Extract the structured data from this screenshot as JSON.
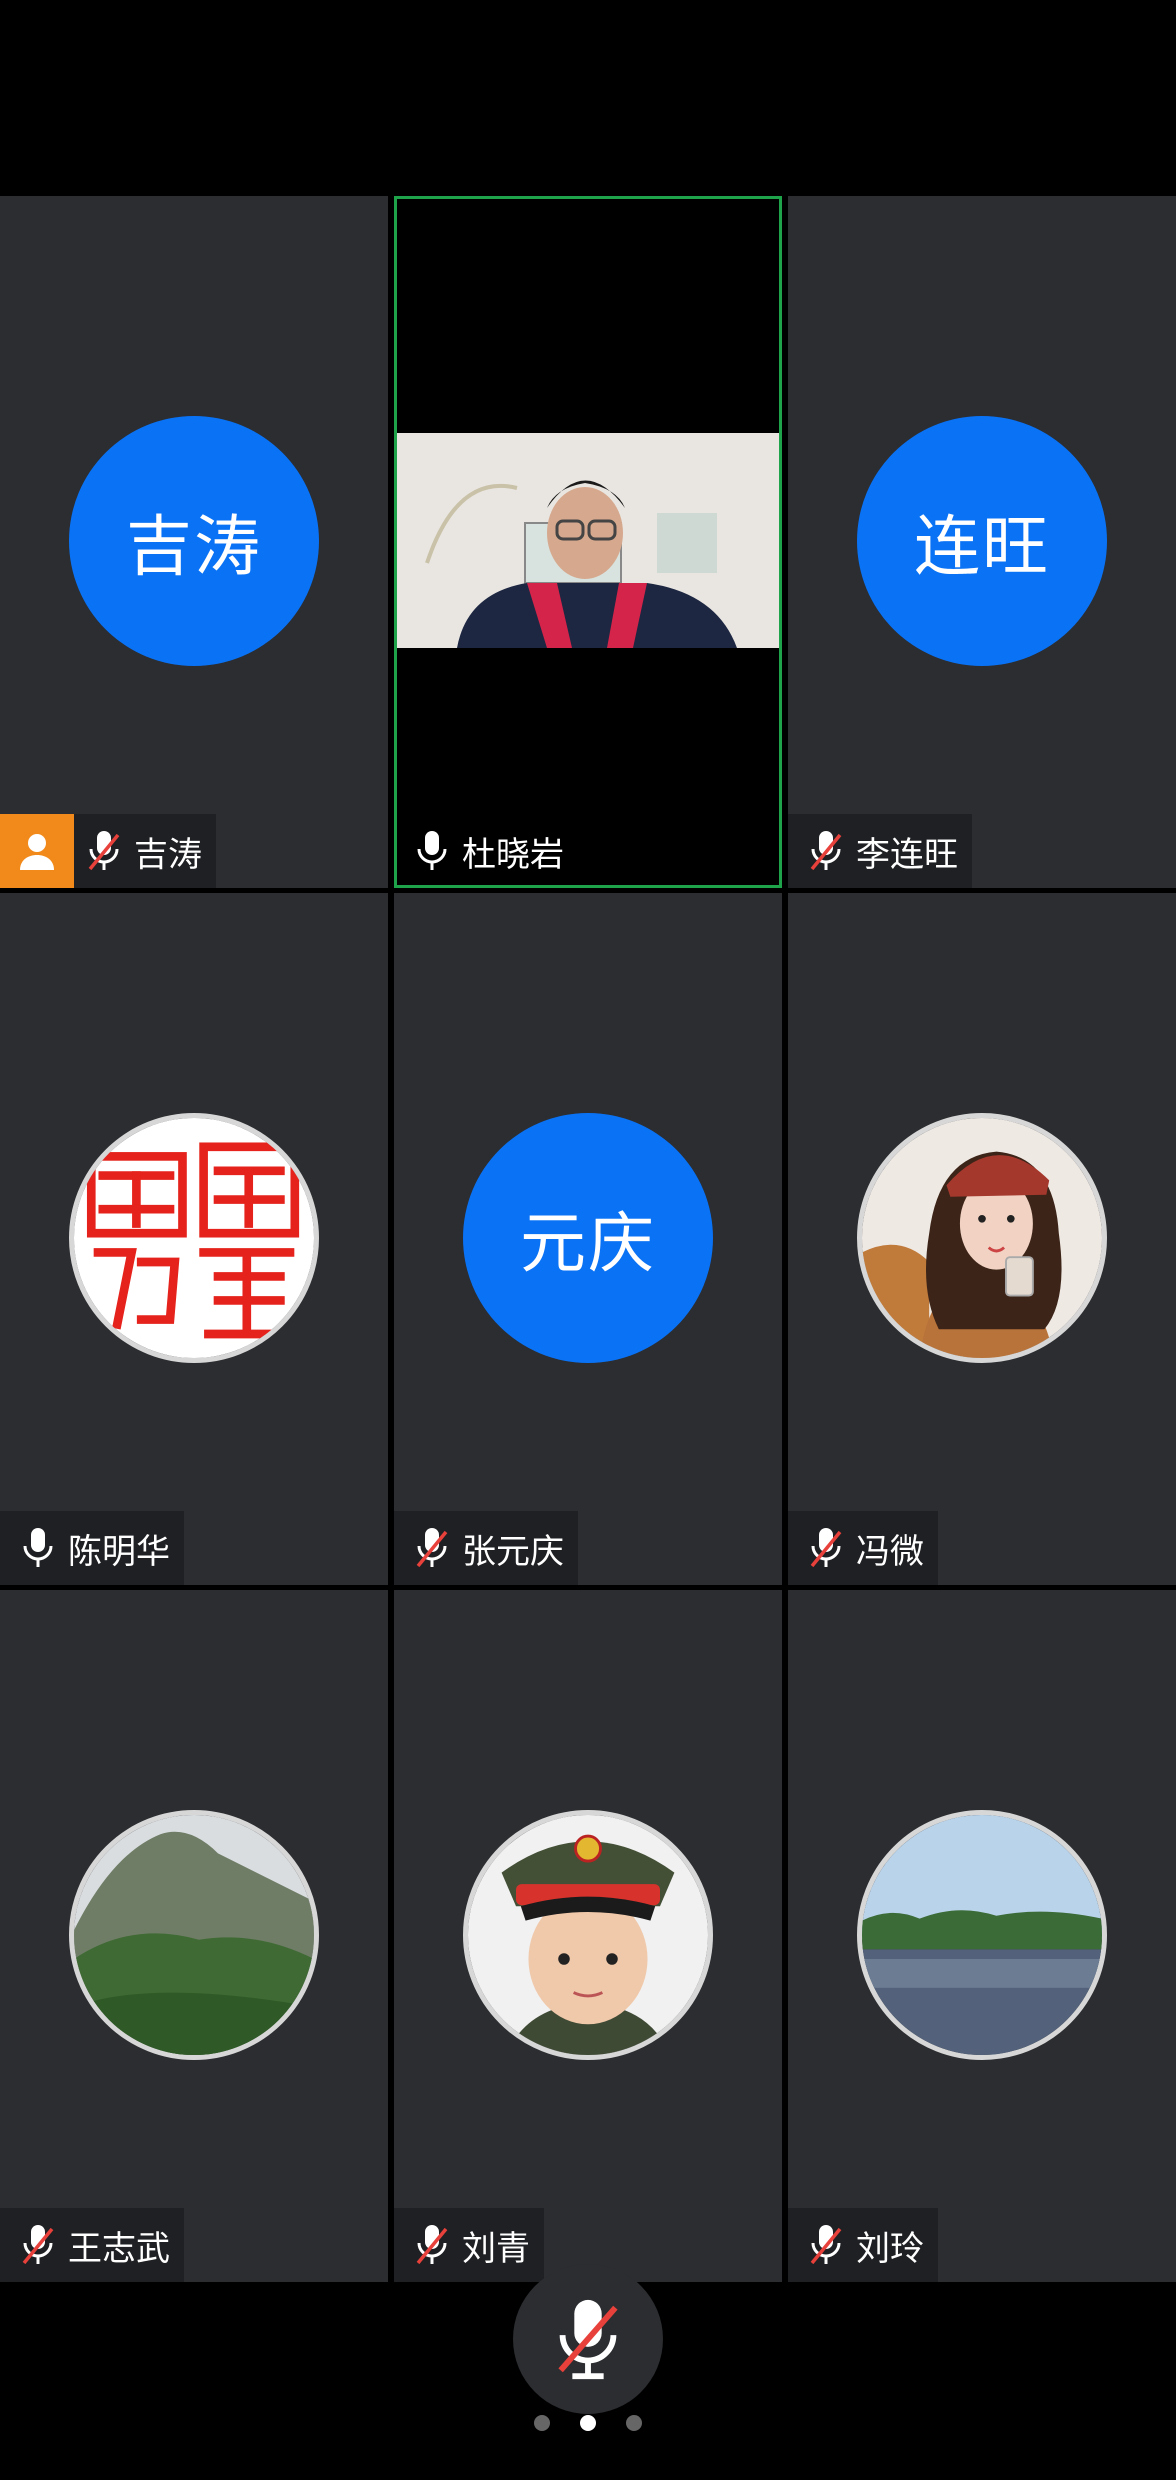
{
  "colors": {
    "accent_blue": "#0a72f5",
    "tile_bg": "#2b2d30",
    "active_border": "#1fa34a",
    "host_badge": "#f28a1b",
    "muted_red": "#e8413b"
  },
  "participants": [
    {
      "name": "吉涛",
      "avatar_text": "吉涛",
      "mic": "muted",
      "host": true
    },
    {
      "name": "杜晓岩",
      "mic": "on",
      "video": true,
      "active_speaker": true
    },
    {
      "name": "李连旺",
      "avatar_text": "连旺",
      "mic": "muted"
    },
    {
      "name": "陈明华",
      "avatar": "red-seal-image",
      "mic": "on"
    },
    {
      "name": "张元庆",
      "avatar_text": "元庆",
      "mic": "muted"
    },
    {
      "name": "冯微",
      "avatar": "girl-photo",
      "mic": "muted"
    },
    {
      "name": "王志武",
      "avatar": "mountain-photo",
      "mic": "muted"
    },
    {
      "name": "刘青",
      "avatar": "boy-cap-photo",
      "mic": "muted"
    },
    {
      "name": "刘玲",
      "avatar": "lake-photo",
      "mic": "muted"
    }
  ],
  "controls": {
    "mic_state": "muted",
    "page_count": 3,
    "current_page": 2
  }
}
